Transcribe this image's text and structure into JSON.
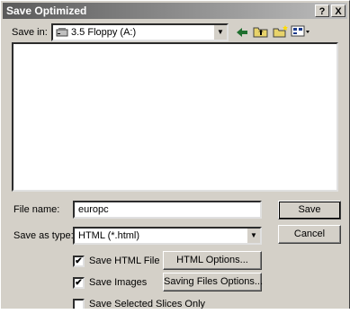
{
  "window": {
    "title": "Save Optimized",
    "help_glyph": "?",
    "close_glyph": "X"
  },
  "location": {
    "label": "Save in:",
    "value": "3.5 Floppy (A:)"
  },
  "fields": {
    "filename_label": "File name:",
    "filename_value": "europc",
    "filetype_label": "Save as type:",
    "filetype_value": "HTML (*.html)"
  },
  "buttons": {
    "save": "Save",
    "cancel": "Cancel",
    "html_options": "HTML Options...",
    "saving_files_options": "Saving Files Options..."
  },
  "options": {
    "save_html": {
      "label": "Save HTML File",
      "checked": true
    },
    "save_images": {
      "label": "Save Images",
      "checked": true
    },
    "save_selected_slices": {
      "label": "Save Selected Slices Only",
      "checked": false
    }
  },
  "check_glyph": "✔",
  "icons": [
    "floppy-drive-icon",
    "back-arrow-icon",
    "up-folder-icon",
    "new-folder-icon",
    "view-menu-icon"
  ]
}
